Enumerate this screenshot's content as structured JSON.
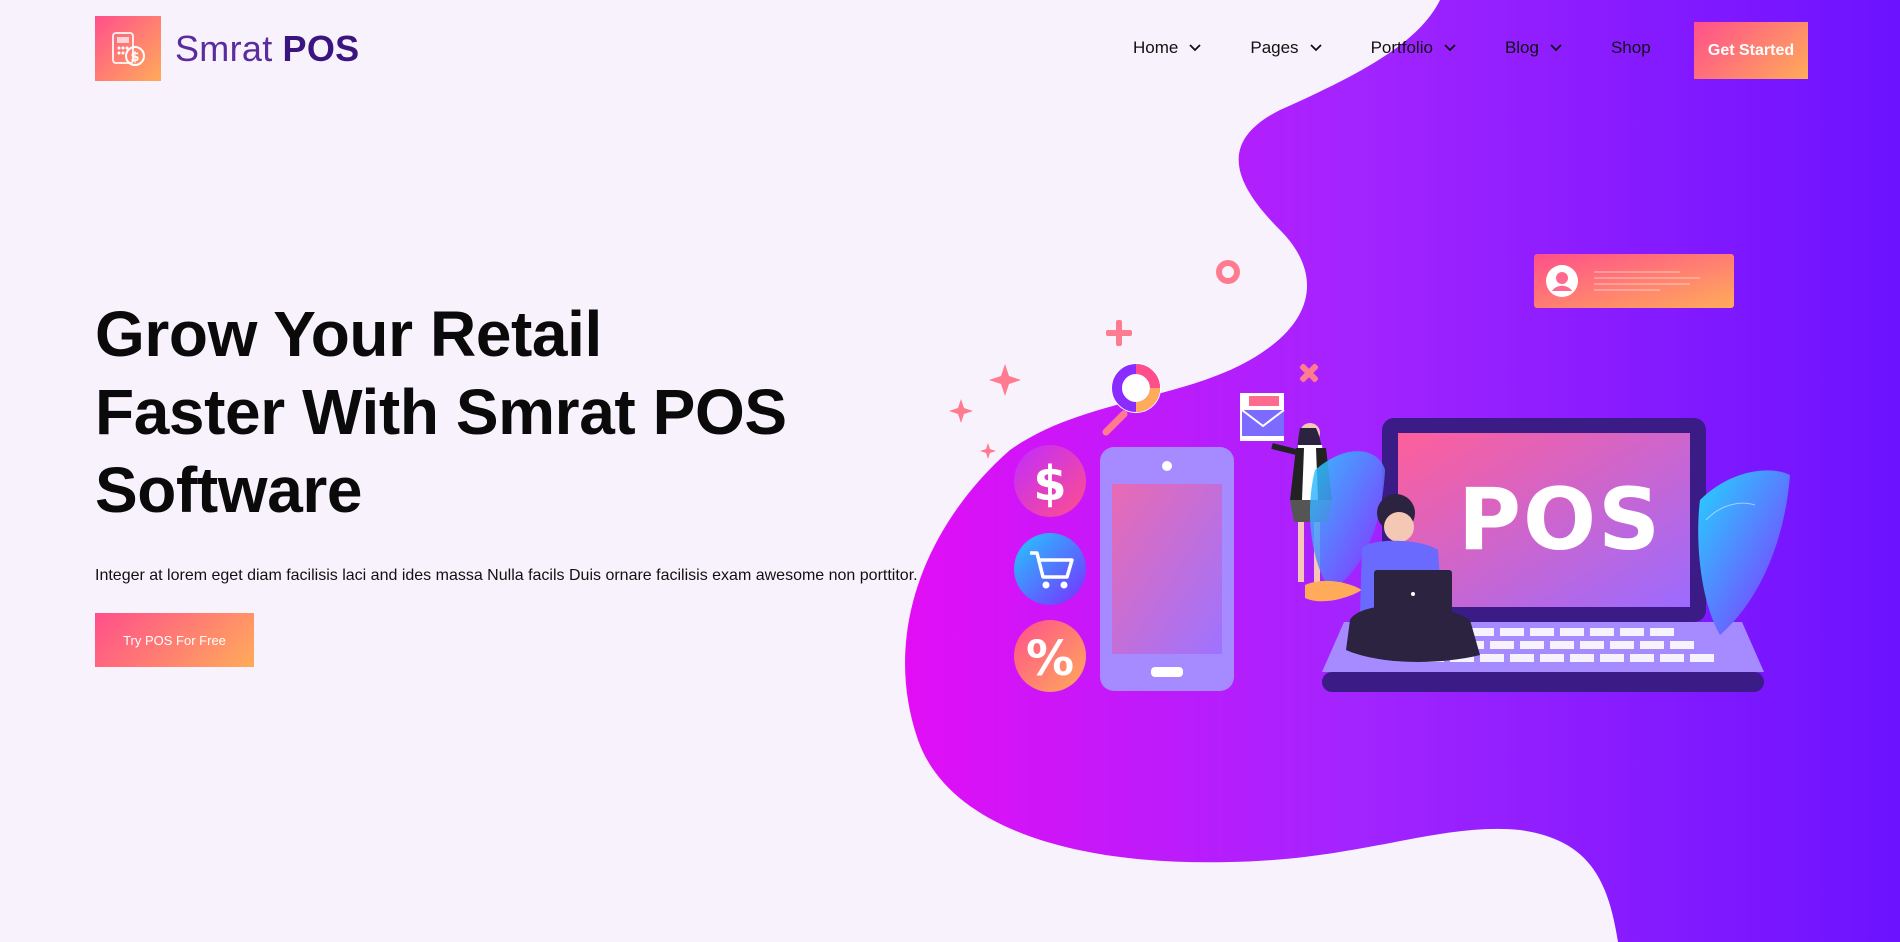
{
  "brand": {
    "name_light": "Smrat",
    "name_bold": "POS",
    "logo_icon": "calculator-dollar-icon"
  },
  "nav": {
    "items": [
      {
        "label": "Home",
        "has_dropdown": true
      },
      {
        "label": "Pages",
        "has_dropdown": true
      },
      {
        "label": "Portfolio",
        "has_dropdown": true
      },
      {
        "label": "Blog",
        "has_dropdown": true
      },
      {
        "label": "Shop",
        "has_dropdown": false
      }
    ],
    "cta_label": "Get Started"
  },
  "hero": {
    "title_lines": [
      "Grow Your Retail",
      "Faster With Smrat POS",
      "Software"
    ],
    "description": "Integer at lorem eget diam facilisis laci and ides massa Nulla facils Duis ornare facilisis exam awesome non porttitor.",
    "button_label": "Try POS For Free"
  },
  "illustration": {
    "laptop_screen_text": "POS",
    "icons": [
      "dollar-icon",
      "cart-icon",
      "percent-icon",
      "magnifier-chart-icon",
      "news-envelope-icon",
      "user-profile-icon"
    ]
  },
  "colors": {
    "page_background": "#f8f2fd",
    "gradient_start": "#ff4f8b",
    "gradient_end": "#ffab5a",
    "blob_left": "#e20ef5",
    "blob_right": "#7413ff",
    "brand_text": "#3a1580"
  }
}
